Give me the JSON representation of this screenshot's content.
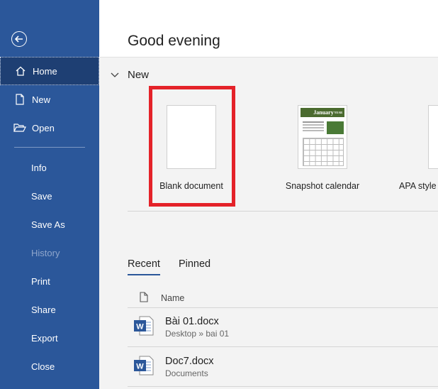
{
  "sidebar": {
    "items": [
      {
        "label": "Home",
        "icon": "home-icon"
      },
      {
        "label": "New",
        "icon": "new-document-icon"
      },
      {
        "label": "Open",
        "icon": "open-folder-icon"
      },
      {
        "label": "Info"
      },
      {
        "label": "Save"
      },
      {
        "label": "Save As"
      },
      {
        "label": "History"
      },
      {
        "label": "Print"
      },
      {
        "label": "Share"
      },
      {
        "label": "Export"
      },
      {
        "label": "Close"
      }
    ]
  },
  "main": {
    "greeting": "Good evening",
    "new_section": {
      "title": "New",
      "templates": [
        {
          "label": "Blank document"
        },
        {
          "label": "Snapshot calendar",
          "thumb_title": "January",
          "thumb_year": "YEAR"
        },
        {
          "label": "APA style r"
        }
      ]
    },
    "tabs": [
      "Recent",
      "Pinned"
    ],
    "column_header": "Name",
    "files": [
      {
        "name": "Bài 01.docx",
        "path": "Desktop » bai 01"
      },
      {
        "name": "Doc7.docx",
        "path": "Documents"
      }
    ]
  },
  "colors": {
    "sidebar": "#2b579a",
    "highlight": "#e42229",
    "word": "#2b579a"
  }
}
